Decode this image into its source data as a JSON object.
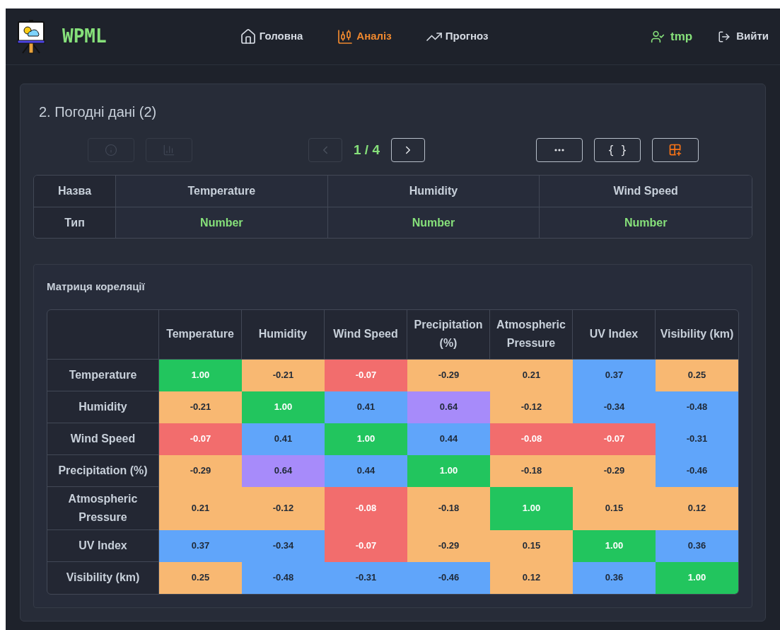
{
  "header": {
    "logo": "WPML",
    "nav": [
      {
        "label": "Головна",
        "kind": "home",
        "selected": false
      },
      {
        "label": "Аналіз",
        "kind": "analysis",
        "selected": true
      },
      {
        "label": "Прогноз",
        "kind": "forecast",
        "selected": false
      }
    ],
    "user": "tmp",
    "logout": "Вийти"
  },
  "dataset": {
    "title": "2. Погодні дані (2)",
    "left_buttons": [
      {
        "kind": "info",
        "disabled": true
      },
      {
        "kind": "chart",
        "disabled": true
      }
    ],
    "pager": {
      "text": "1 / 4",
      "prev_disabled": true,
      "next_disabled": false
    },
    "right_buttons": [
      {
        "kind": "more"
      },
      {
        "kind": "json",
        "label": "{ }"
      },
      {
        "kind": "table-add"
      }
    ],
    "fields": [
      {
        "kind": "name",
        "label": "Назва",
        "cells": [
          "Temperature",
          "Humidity",
          "Wind Speed"
        ]
      },
      {
        "kind": "type",
        "label": "Тип",
        "cells": [
          "Number",
          "Number",
          "Number"
        ]
      }
    ]
  },
  "matrix": {
    "title": "Матриця кореляції",
    "columns": [
      "Temperature",
      "Humidity",
      "Wind Speed",
      "Precipitation (%)",
      "Atmospheric Pressure",
      "UV Index",
      "Visibility (km)"
    ],
    "rows": [
      {
        "label": "Temperature",
        "cells": [
          {
            "value": "1.00",
            "color": "#22c55e"
          },
          {
            "value": "-0.21",
            "color": "#f8b872"
          },
          {
            "value": "-0.07",
            "color": "#f26d6d"
          },
          {
            "value": "-0.29",
            "color": "#f8b872"
          },
          {
            "value": "0.21",
            "color": "#f8b872"
          },
          {
            "value": "0.37",
            "color": "#60a5fa"
          },
          {
            "value": "0.25",
            "color": "#f8b872"
          }
        ]
      },
      {
        "label": "Humidity",
        "cells": [
          {
            "value": "-0.21",
            "color": "#f8b872"
          },
          {
            "value": "1.00",
            "color": "#22c55e"
          },
          {
            "value": "0.41",
            "color": "#60a5fa"
          },
          {
            "value": "0.64",
            "color": "#a78bfa"
          },
          {
            "value": "-0.12",
            "color": "#f8b872"
          },
          {
            "value": "-0.34",
            "color": "#60a5fa"
          },
          {
            "value": "-0.48",
            "color": "#60a5fa"
          }
        ]
      },
      {
        "label": "Wind Speed",
        "cells": [
          {
            "value": "-0.07",
            "color": "#f26d6d"
          },
          {
            "value": "0.41",
            "color": "#60a5fa"
          },
          {
            "value": "1.00",
            "color": "#22c55e"
          },
          {
            "value": "0.44",
            "color": "#60a5fa"
          },
          {
            "value": "-0.08",
            "color": "#f26d6d"
          },
          {
            "value": "-0.07",
            "color": "#f26d6d"
          },
          {
            "value": "-0.31",
            "color": "#60a5fa"
          }
        ]
      },
      {
        "label": "Precipitation (%)",
        "cells": [
          {
            "value": "-0.29",
            "color": "#f8b872"
          },
          {
            "value": "0.64",
            "color": "#a78bfa"
          },
          {
            "value": "0.44",
            "color": "#60a5fa"
          },
          {
            "value": "1.00",
            "color": "#22c55e"
          },
          {
            "value": "-0.18",
            "color": "#f8b872"
          },
          {
            "value": "-0.29",
            "color": "#f8b872"
          },
          {
            "value": "-0.46",
            "color": "#60a5fa"
          }
        ]
      },
      {
        "label": "Atmospheric Pressure",
        "cells": [
          {
            "value": "0.21",
            "color": "#f8b872"
          },
          {
            "value": "-0.12",
            "color": "#f8b872"
          },
          {
            "value": "-0.08",
            "color": "#f26d6d"
          },
          {
            "value": "-0.18",
            "color": "#f8b872"
          },
          {
            "value": "1.00",
            "color": "#22c55e"
          },
          {
            "value": "0.15",
            "color": "#f8b872"
          },
          {
            "value": "0.12",
            "color": "#f8b872"
          }
        ]
      },
      {
        "label": "UV Index",
        "cells": [
          {
            "value": "0.37",
            "color": "#60a5fa"
          },
          {
            "value": "-0.34",
            "color": "#60a5fa"
          },
          {
            "value": "-0.07",
            "color": "#f26d6d"
          },
          {
            "value": "-0.29",
            "color": "#f8b872"
          },
          {
            "value": "0.15",
            "color": "#f8b872"
          },
          {
            "value": "1.00",
            "color": "#22c55e"
          },
          {
            "value": "0.36",
            "color": "#60a5fa"
          }
        ]
      },
      {
        "label": "Visibility (km)",
        "cells": [
          {
            "value": "0.25",
            "color": "#f8b872"
          },
          {
            "value": "-0.48",
            "color": "#60a5fa"
          },
          {
            "value": "-0.31",
            "color": "#60a5fa"
          },
          {
            "value": "-0.46",
            "color": "#60a5fa"
          },
          {
            "value": "0.12",
            "color": "#f8b872"
          },
          {
            "value": "0.36",
            "color": "#60a5fa"
          },
          {
            "value": "1.00",
            "color": "#22c55e"
          }
        ]
      }
    ]
  }
}
